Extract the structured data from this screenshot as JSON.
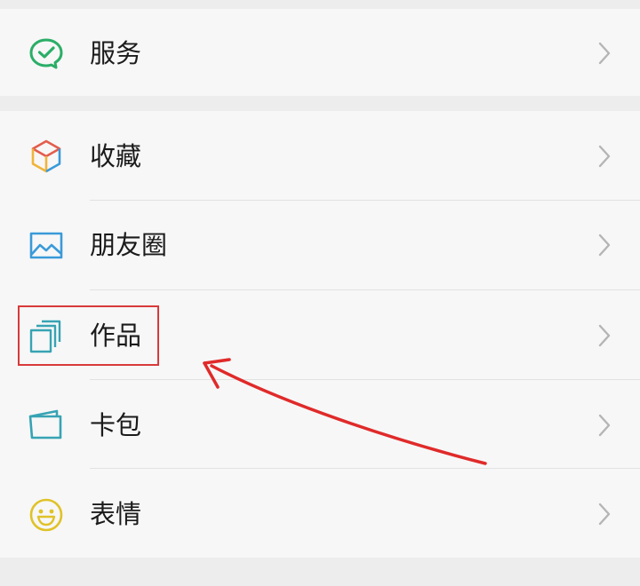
{
  "menu": {
    "group1": {
      "items": [
        {
          "label": "服务",
          "icon": "wechat-pay-icon",
          "icon_color": "#2aae67"
        }
      ]
    },
    "group2": {
      "items": [
        {
          "label": "收藏",
          "icon": "favorites-cube-icon"
        },
        {
          "label": "朋友圈",
          "icon": "moments-image-icon",
          "icon_color": "#3a9ad9"
        },
        {
          "label": "作品",
          "icon": "works-stack-icon",
          "icon_color": "#37a3b3"
        },
        {
          "label": "卡包",
          "icon": "card-wallet-icon",
          "icon_color": "#37a3b3"
        },
        {
          "label": "表情",
          "icon": "smiley-icon",
          "icon_color": "#e0c228"
        }
      ]
    }
  },
  "annotation": {
    "highlight_color": "#d83a3a",
    "highlighted_item": "作品"
  }
}
